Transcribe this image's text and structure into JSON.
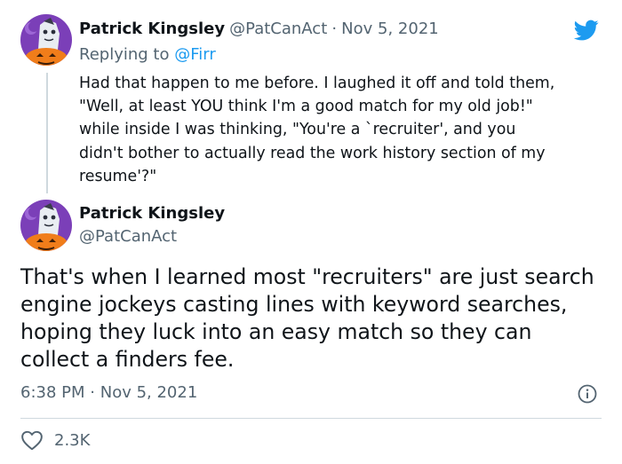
{
  "reply_tweet": {
    "display_name": "Patrick Kingsley",
    "handle": "@PatCanAct",
    "separator": "·",
    "date": "Nov 5, 2021",
    "replying_prefix": "Replying to ",
    "replying_to": "@Firr",
    "text": "Had that happen to me before. I laughed it off and told them,\n\"Well, at least YOU think I'm a good match for my old job!\"\nwhile inside I was thinking, \"You're a `recruiter', and you\ndidn't bother to actually read the work history section of my\nresume'?\""
  },
  "main_tweet": {
    "display_name": "Patrick Kingsley",
    "handle": "@PatCanAct",
    "text": "That's when I learned most \"recruiters\" are just search engine jockeys casting lines with keyword searches, hoping they luck into an easy match so they can collect a finders fee.",
    "time": "6:38 PM",
    "separator": "·",
    "date": "Nov 5, 2021",
    "likes": "2.3K"
  },
  "icons": {
    "logo": "twitter-bird-icon",
    "info": "info-icon",
    "like": "heart-icon"
  },
  "colors": {
    "brand": "#1d9bf0",
    "secondary_text": "#536471",
    "avatar_bg": "#7b3fb8",
    "avatar_pumpkin": "#f07d1a"
  }
}
